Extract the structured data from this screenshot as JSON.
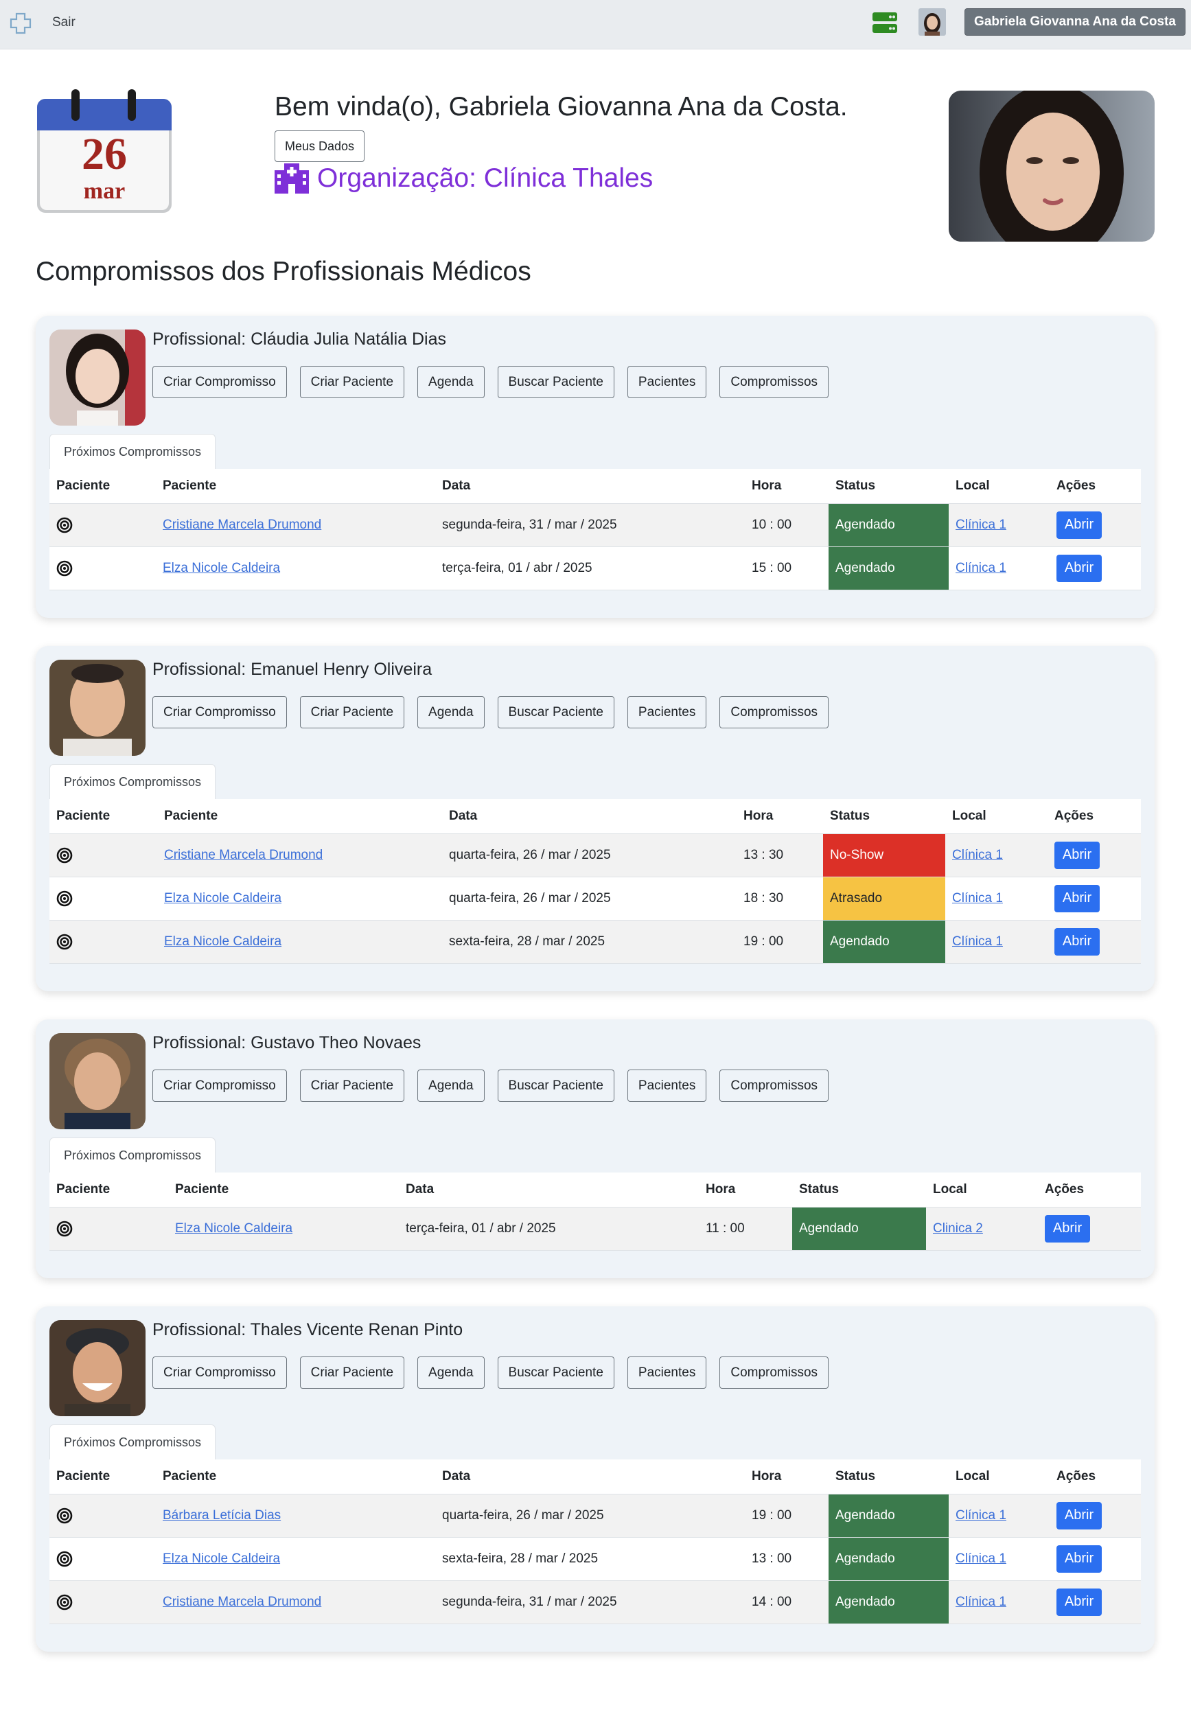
{
  "navbar": {
    "logout_label": "Sair",
    "user_button_label": "Gabriela Giovanna Ana da Costa",
    "server_icon_color": "#2e8b22"
  },
  "calendar": {
    "day": "26",
    "month": "mar"
  },
  "header": {
    "welcome": "Bem vinda(o), Gabriela Giovanna Ana da Costa.",
    "my_data_label": "Meus Dados",
    "organization": "Organização: Clínica Thales",
    "org_color": "#7e2fd8"
  },
  "section_title": "Compromissos dos Profissionais Médicos",
  "status_colors": {
    "Agendado": "#3b7a4c",
    "No-Show": "#dc3027",
    "Atrasado": "#f6c343"
  },
  "professionals": [
    {
      "name": "Profissional: Cláudia Julia Natália Dias",
      "actions": [
        "Criar Compromisso",
        "Criar Paciente",
        "Agenda",
        "Buscar Paciente",
        "Pacientes",
        "Compromissos"
      ],
      "tab": "Próximos Compromissos",
      "headers": [
        "Paciente",
        "Paciente",
        "Data",
        "Hora",
        "Status",
        "Local",
        "Ações"
      ],
      "rows": [
        {
          "patient": "Cristiane Marcela Drumond",
          "date": "segunda-feira, 31 / mar / 2025",
          "time": "10 : 00",
          "status": "Agendado",
          "place": "Clínica 1",
          "action": "Abrir"
        },
        {
          "patient": "Elza Nicole Caldeira",
          "date": "terça-feira, 01 / abr / 2025",
          "time": "15 : 00",
          "status": "Agendado",
          "place": "Clínica 1",
          "action": "Abrir"
        }
      ]
    },
    {
      "name": "Profissional: Emanuel Henry Oliveira",
      "actions": [
        "Criar Compromisso",
        "Criar Paciente",
        "Agenda",
        "Buscar Paciente",
        "Pacientes",
        "Compromissos"
      ],
      "tab": "Próximos Compromissos",
      "headers": [
        "Paciente",
        "Paciente",
        "Data",
        "Hora",
        "Status",
        "Local",
        "Ações"
      ],
      "rows": [
        {
          "patient": "Cristiane Marcela Drumond",
          "date": "quarta-feira, 26 / mar / 2025",
          "time": "13 : 30",
          "status": "No-Show",
          "place": "Clínica 1",
          "action": "Abrir"
        },
        {
          "patient": "Elza Nicole Caldeira",
          "date": "quarta-feira, 26 / mar / 2025",
          "time": "18 : 30",
          "status": "Atrasado",
          "place": "Clínica 1",
          "action": "Abrir"
        },
        {
          "patient": "Elza Nicole Caldeira",
          "date": "sexta-feira, 28 / mar / 2025",
          "time": "19 : 00",
          "status": "Agendado",
          "place": "Clínica 1",
          "action": "Abrir"
        }
      ]
    },
    {
      "name": "Profissional: Gustavo Theo Novaes",
      "actions": [
        "Criar Compromisso",
        "Criar Paciente",
        "Agenda",
        "Buscar Paciente",
        "Pacientes",
        "Compromissos"
      ],
      "tab": "Próximos Compromissos",
      "headers": [
        "Paciente",
        "Paciente",
        "Data",
        "Hora",
        "Status",
        "Local",
        "Ações"
      ],
      "rows": [
        {
          "patient": "Elza Nicole Caldeira",
          "date": "terça-feira, 01 / abr / 2025",
          "time": "11 : 00",
          "status": "Agendado",
          "place": "Clinica 2",
          "action": "Abrir"
        }
      ]
    },
    {
      "name": "Profissional: Thales Vicente Renan Pinto",
      "actions": [
        "Criar Compromisso",
        "Criar Paciente",
        "Agenda",
        "Buscar Paciente",
        "Pacientes",
        "Compromissos"
      ],
      "tab": "Próximos Compromissos",
      "headers": [
        "Paciente",
        "Paciente",
        "Data",
        "Hora",
        "Status",
        "Local",
        "Ações"
      ],
      "rows": [
        {
          "patient": "Bárbara Letícia Dias",
          "date": "quarta-feira, 26 / mar / 2025",
          "time": "19 : 00",
          "status": "Agendado",
          "place": "Clínica 1",
          "action": "Abrir"
        },
        {
          "patient": "Elza Nicole Caldeira",
          "date": "sexta-feira, 28 / mar / 2025",
          "time": "13 : 00",
          "status": "Agendado",
          "place": "Clínica 1",
          "action": "Abrir"
        },
        {
          "patient": "Cristiane Marcela Drumond",
          "date": "segunda-feira, 31 / mar / 2025",
          "time": "14 : 00",
          "status": "Agendado",
          "place": "Clínica 1",
          "action": "Abrir"
        }
      ]
    }
  ]
}
